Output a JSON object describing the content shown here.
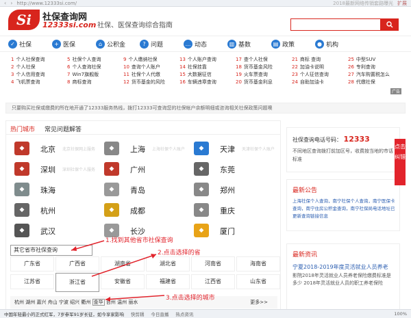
{
  "browser": {
    "back": "‹",
    "forward": "›",
    "url": "http://www.12333si.com/",
    "tab_hint": "2018最新网络传销套路曝光",
    "extension": "扩展"
  },
  "header": {
    "logo_mark": "Si",
    "logo_title": "社保查询网",
    "logo_domain": "12333si.com",
    "slogan": "社保、医保查询综合指南",
    "search_placeholder": ""
  },
  "nav": [
    {
      "label": "社保",
      "icon": "shield-icon"
    },
    {
      "label": "医保",
      "icon": "plus-icon"
    },
    {
      "label": "公积金",
      "icon": "house-icon"
    },
    {
      "label": "问题",
      "icon": "question-icon"
    },
    {
      "label": "动态",
      "icon": "chat-icon"
    },
    {
      "label": "基数",
      "icon": "chart-icon"
    },
    {
      "label": "政策",
      "icon": "book-icon"
    },
    {
      "label": "机构",
      "icon": "org-icon"
    }
  ],
  "links": [
    [
      "1 个人社保查询",
      "2 个人社保",
      "3 个人信用查询",
      "4 飞机票查询"
    ],
    [
      "5 社保个人查询",
      "6 个人查询社保",
      "7 Win7旗舰版",
      "8 商标查询"
    ],
    [
      "9 个人缴纳社保",
      "10 查询个人账户",
      "11 社保个人代缴",
      "12 货币基金的风险"
    ],
    [
      "13 个人账户查询",
      "14 社保挂靠",
      "15 大数据征信",
      "16 车辆违章查询"
    ],
    [
      "17 查个人社保",
      "18 货币基金风险",
      "19 火车票查询",
      "20 货币基金利息"
    ],
    [
      "21 商标 查询",
      "22 加油卡说明",
      "23 个人征信查询",
      "24 自助加油卡"
    ],
    [
      "25 中型SUV",
      "26 专利查询",
      "27 汽车购置税怎么",
      "28 代缴社保"
    ]
  ],
  "ad_label": "广告",
  "notice": "只要购买社保或缴费的所在地开通了12333服务热线，拨打12333可查询您的社保帐户余额明细或咨询相关社保政策问题噢",
  "tabs": {
    "hot": "热门城市",
    "faq": "常见问题解答"
  },
  "cities": [
    {
      "name": "北京",
      "sub": "北京社保网上服务",
      "color": "#c0392b"
    },
    {
      "name": "上海",
      "sub": "上海社保个人账户",
      "color": "#888888"
    },
    {
      "name": "天津",
      "sub": "天津社保个人账户",
      "color": "#2a7ad2"
    },
    {
      "name": "深圳",
      "sub": "深圳社保个人服务",
      "color": "#c0392b"
    },
    {
      "name": "广州",
      "sub": "",
      "color": "#c0392b"
    },
    {
      "name": "东莞",
      "sub": "",
      "color": "#666666"
    },
    {
      "name": "珠海",
      "sub": "",
      "color": "#7f8c8d"
    },
    {
      "name": "青岛",
      "sub": "",
      "color": "#999999"
    },
    {
      "name": "郑州",
      "sub": "",
      "color": "#888888"
    },
    {
      "name": "杭州",
      "sub": "",
      "color": "#666666"
    },
    {
      "name": "成都",
      "sub": "",
      "color": "#d4a017"
    },
    {
      "name": "重庆",
      "sub": "",
      "color": "#888888"
    },
    {
      "name": "武汉",
      "sub": "",
      "color": "#555555"
    },
    {
      "name": "长沙",
      "sub": "",
      "color": "#999999"
    },
    {
      "name": "厦门",
      "sub": "",
      "color": "#e8a317"
    }
  ],
  "other_provinces_label": "其它省市社保查询",
  "provinces": [
    [
      "广东省",
      "广西省",
      "湖南省",
      "湖北省",
      "河南省",
      "海南省"
    ],
    [
      "江苏省",
      "浙江省",
      "安徽省",
      "福建省",
      "江西省",
      "山东省"
    ]
  ],
  "selected_province": "浙江省",
  "city_list": [
    "杭州",
    "湖州",
    "嘉兴",
    "舟山",
    "宁波",
    "绍兴",
    "衢州",
    "金华",
    "台州",
    "温州",
    "丽水"
  ],
  "selected_city": "金华",
  "more": "更多>>",
  "annotations": {
    "step1": "1.找到其他省市社保查询",
    "step2": "2.点击选择的省",
    "step3": "3.点击选择的城市"
  },
  "right": {
    "phone_label": "社保查询电话号码：",
    "phone_number": "12333",
    "phone_desc": "不同地区查询拨打前加区号，收费按当地的市话标准",
    "news_title": "最新公告",
    "news_body": "上海社保个人查询，南宁社保个人查询，南宁医保卡查询，南宁住房公积金查询，南宁社保局电话地址已更新查询链接信息",
    "info_title": "最新资讯",
    "info_lead": "宁夏2018-2019年度灵活就业人员养老",
    "info_body": "影院2018年灵活就业人员养老保险缴费标准是多少 2018年灵活就业人员的职工养老保险",
    "side_tab": "点击纠错"
  },
  "status": {
    "news": "中国年轻最小的正式红军，7岁参军91岁长征，如今享家影响",
    "items": [
      "快剪辑",
      "今日直播",
      "热点资讯"
    ],
    "zoom": "100%"
  },
  "colors": {
    "brand_red": "#d8251d",
    "nav_blue": "#2a7ad2"
  }
}
